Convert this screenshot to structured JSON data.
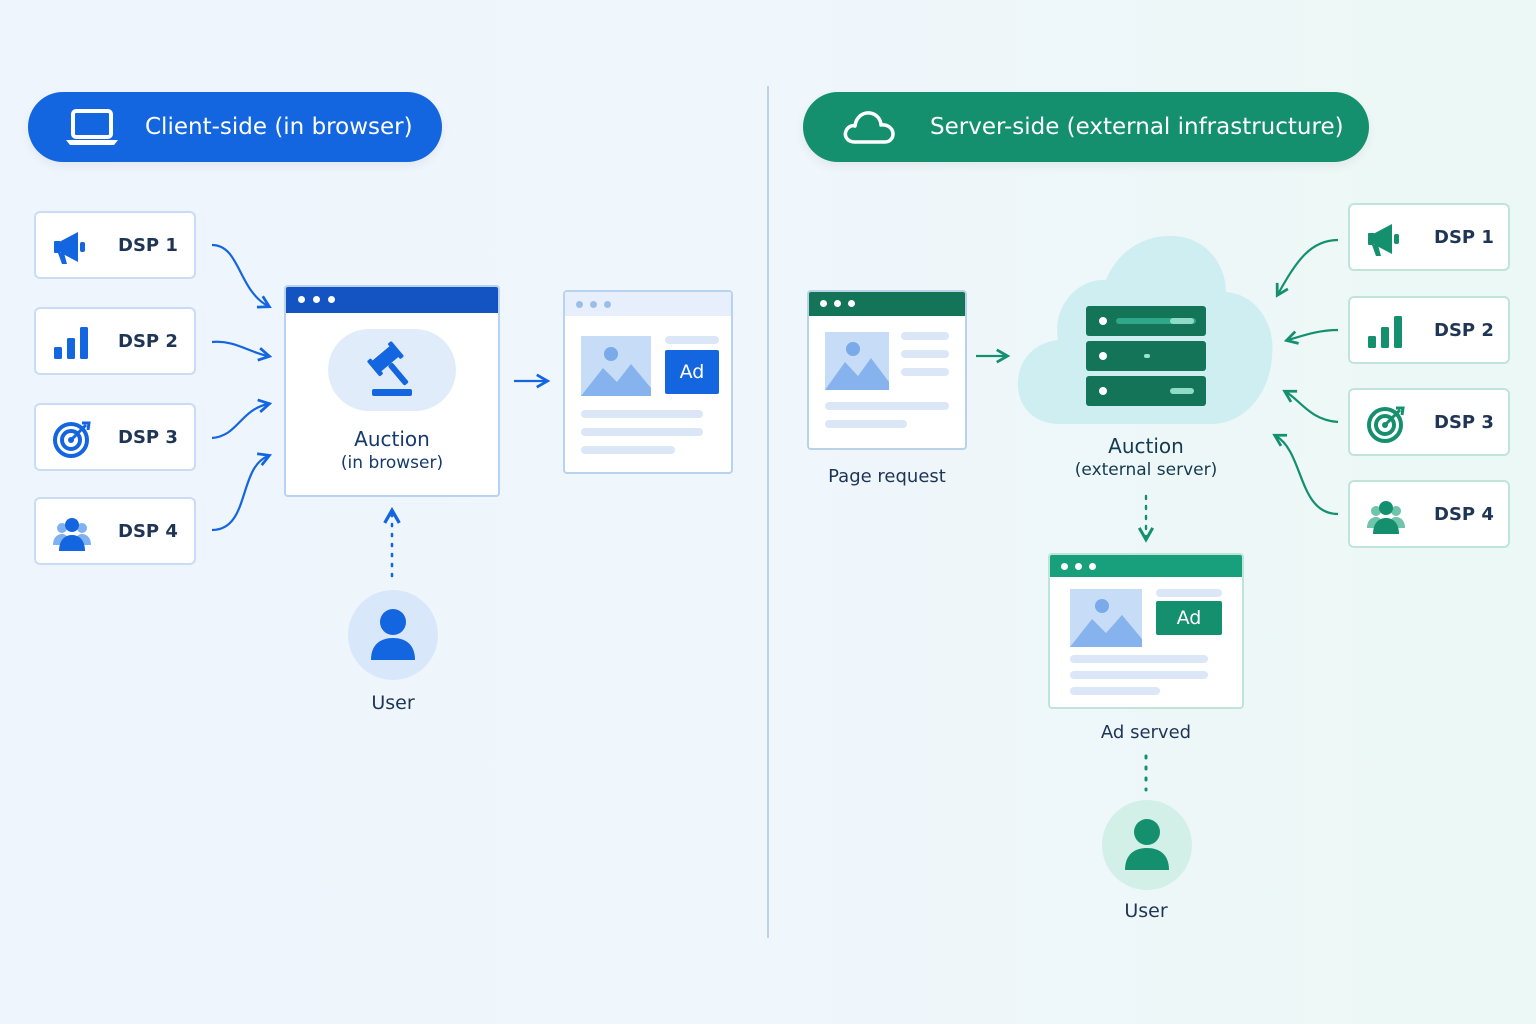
{
  "client_side": {
    "title": "Client-side (in browser)",
    "dsps": [
      {
        "label": "DSP 1",
        "icon": "megaphone-icon"
      },
      {
        "label": "DSP 2",
        "icon": "bar-chart-icon"
      },
      {
        "label": "DSP 3",
        "icon": "target-icon"
      },
      {
        "label": "DSP 4",
        "icon": "users-icon"
      }
    ],
    "auction": {
      "title": "Auction",
      "subtitle": "(in browser)",
      "icon": "gavel-icon"
    },
    "ad_label": "Ad",
    "user_label": "User",
    "color": "#1466e0"
  },
  "server_side": {
    "title": "Server-side (external infrastructure)",
    "dsps": [
      {
        "label": "DSP 1",
        "icon": "megaphone-icon"
      },
      {
        "label": "DSP 2",
        "icon": "bar-chart-icon"
      },
      {
        "label": "DSP 3",
        "icon": "target-icon"
      },
      {
        "label": "DSP 4",
        "icon": "users-icon"
      }
    ],
    "page_request_label": "Page request",
    "auction": {
      "title": "Auction",
      "subtitle": "(external server)",
      "icon": "server-icon"
    },
    "ad_label": "Ad",
    "ad_served_label": "Ad served",
    "user_label": "User",
    "color": "#14906f"
  }
}
